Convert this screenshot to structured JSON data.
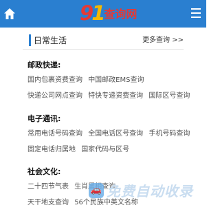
{
  "header": {
    "logo_digits_first": "9",
    "logo_digits_second": "1",
    "logo_text": "查询网",
    "background_color": "#2a7fd0"
  },
  "icons": {
    "home": "home-icon",
    "menu": "menu-icon",
    "watermark": "car-badge-icon"
  },
  "section": {
    "title": "日常生活",
    "more_label": "更多查询 >>"
  },
  "categories": [
    {
      "title": "邮政快递:",
      "links": [
        [
          "国内包裹资费查询",
          "中国邮政EMS查询"
        ],
        [
          "快递公司网点查询",
          "特快专递资费查询",
          "国际区号查询"
        ]
      ]
    },
    {
      "title": "电子通讯:",
      "links": [
        [
          "常用电话号码查询",
          "全国电话区号查询",
          "手机号码查询"
        ],
        [
          "固定电话归属地",
          "国家代码与区号"
        ]
      ]
    },
    {
      "title": "社会文化:",
      "links": [
        [
          "二十四节气表",
          "生肖属相查询"
        ],
        [
          "天干地支查询",
          "56个民族中英文名称"
        ]
      ]
    }
  ],
  "watermark": {
    "text": "免费自动收录"
  }
}
